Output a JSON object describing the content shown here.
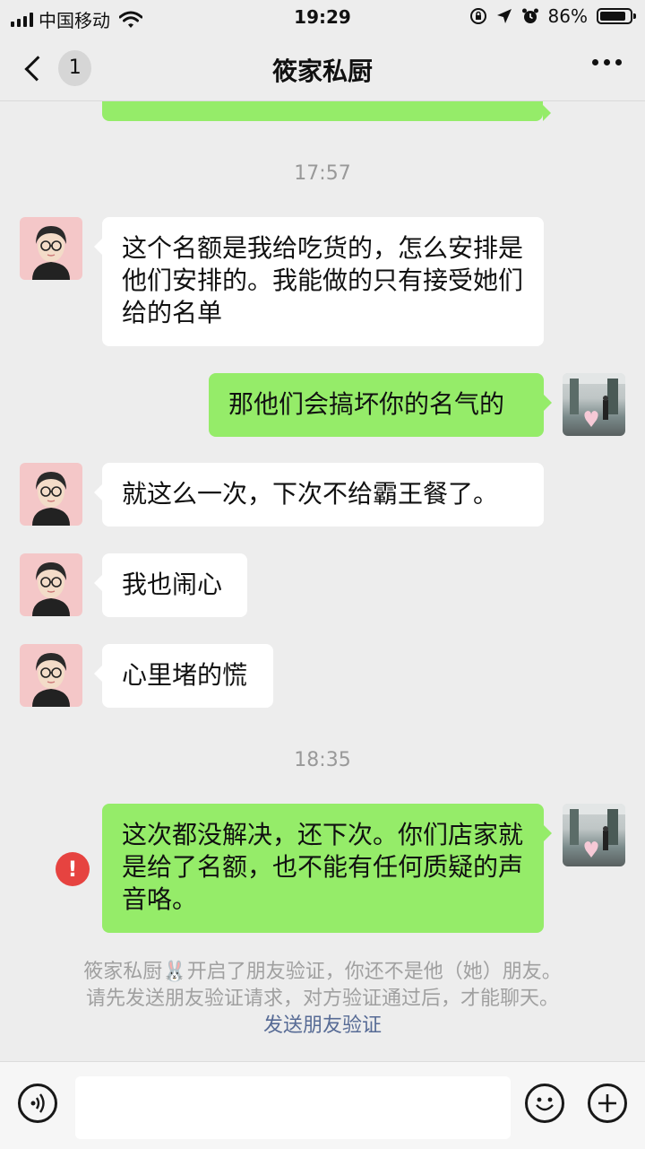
{
  "status_bar": {
    "carrier": "中国移动",
    "time": "19:29",
    "battery": "86%",
    "battery_level": 0.86
  },
  "nav": {
    "unread_count": "1",
    "title": "筱家私厨"
  },
  "messages": [
    {
      "type": "time",
      "text": "17:57"
    },
    {
      "type": "in",
      "text": "这个名额是我给吃货的，怎么安排是他们安排的。我能做的只有接受她们给的名单"
    },
    {
      "type": "out",
      "text": "那他们会搞坏你的名气的"
    },
    {
      "type": "in",
      "text": "就这么一次，下次不给霸王餐了。"
    },
    {
      "type": "in",
      "text": "我也闹心"
    },
    {
      "type": "in",
      "text": "心里堵的慌"
    },
    {
      "type": "time",
      "text": "18:35"
    },
    {
      "type": "out",
      "text": "这次都没解决，还下次。你们店家就是给了名额，也不能有任何质疑的声音咯。",
      "failed": true
    }
  ],
  "system_notice": {
    "line1": "筱家私厨🐰开启了朋友验证，你还不是他（她）朋友。",
    "line2": "请先发送朋友验证请求，对方验证通过后，才能聊天。",
    "link": "发送朋友验证"
  },
  "error_icon": "!",
  "colors": {
    "incoming_bubble": "#ffffff",
    "outgoing_bubble": "#95ec69",
    "error": "#e64340",
    "link": "#576b95"
  },
  "icons": [
    "signal-icon",
    "wifi-icon",
    "lock-rotation-icon",
    "location-icon",
    "alarm-icon",
    "battery-icon",
    "back-chevron-icon",
    "more-icon",
    "voice-icon",
    "emoji-icon",
    "plus-icon"
  ]
}
